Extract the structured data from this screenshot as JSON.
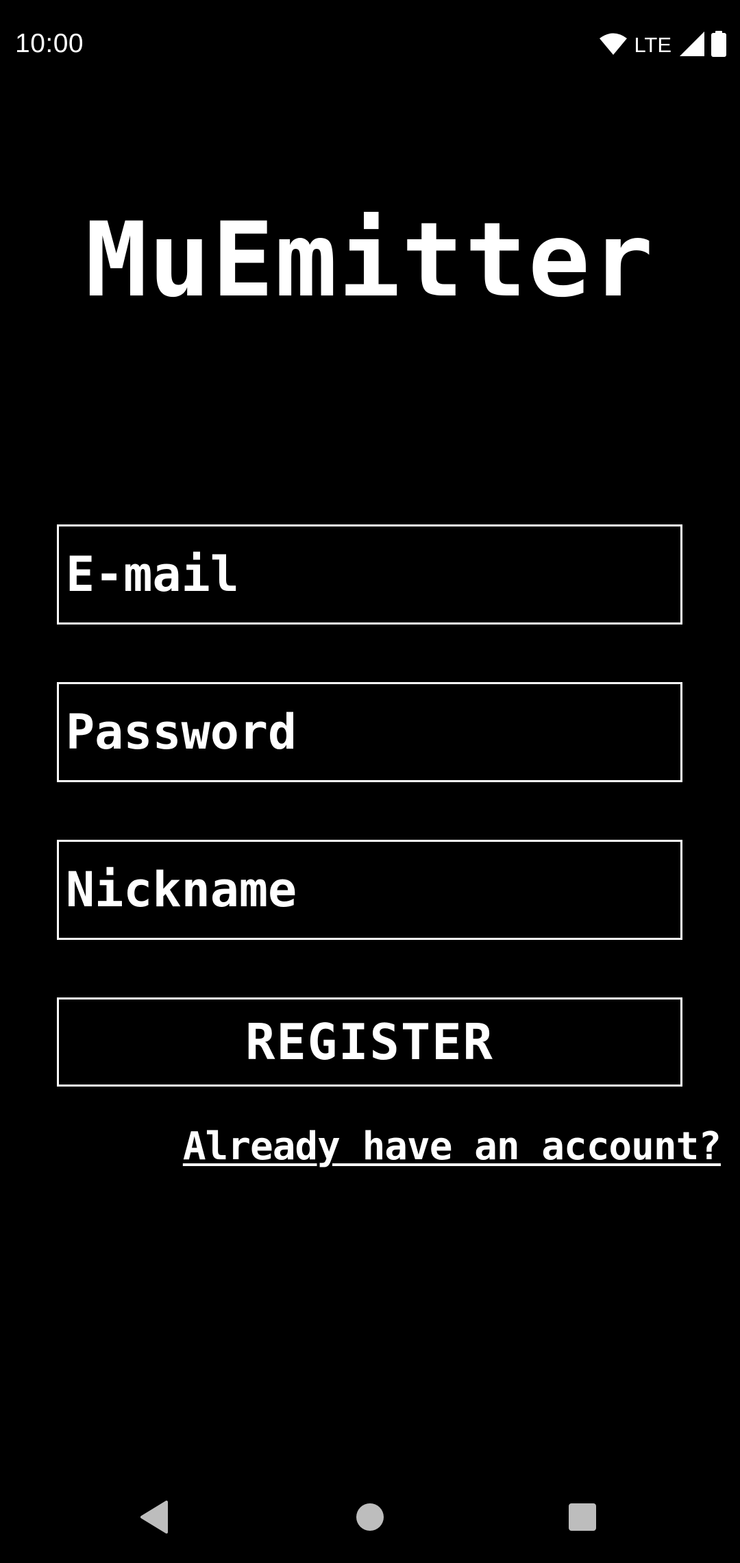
{
  "status_bar": {
    "time": "10:00",
    "network_label": "LTE",
    "icons": [
      "wifi-icon",
      "cell-signal-icon",
      "battery-icon"
    ]
  },
  "app": {
    "title": "MuEmitter"
  },
  "form": {
    "email_placeholder": "E-mail",
    "password_placeholder": "Password",
    "nickname_placeholder": "Nickname",
    "email_value": "",
    "password_value": "",
    "nickname_value": "",
    "register_label": "REGISTER",
    "login_link_label": "Already have an account?"
  },
  "nav_bar": {
    "icons": [
      "back-icon",
      "home-icon",
      "recents-icon"
    ]
  },
  "colors": {
    "background": "#000000",
    "foreground": "#ffffff",
    "nav_icon": "#bdbdbd"
  }
}
